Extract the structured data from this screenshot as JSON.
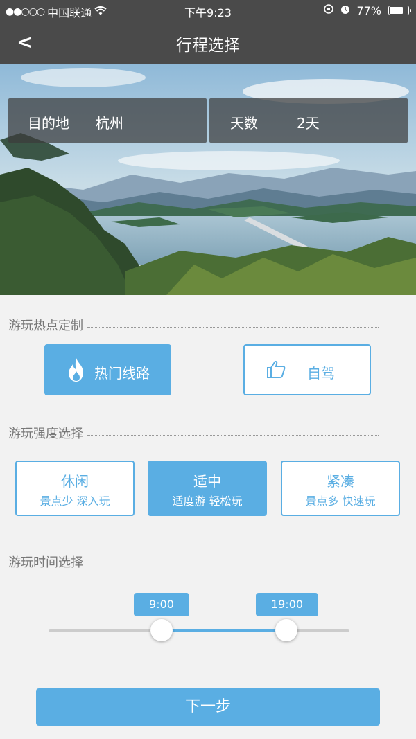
{
  "status_bar": {
    "signal": "●●○○○",
    "carrier": "中国联通",
    "time": "下午9:23",
    "battery": "77%",
    "battery_level": 0.77
  },
  "nav": {
    "back_label": "<",
    "title": "行程选择"
  },
  "trip": {
    "destination_label": "目的地",
    "destination_value": "杭州",
    "days_label": "天数",
    "days_value": "2天"
  },
  "hotspot": {
    "title": "游玩热点定制",
    "options": [
      {
        "label": "热门线路",
        "icon": "flame-icon",
        "selected": true
      },
      {
        "label": "自驾",
        "icon": "thumbs-up-icon",
        "selected": false
      }
    ]
  },
  "intensity": {
    "title": "游玩强度选择",
    "options": [
      {
        "label": "休闲",
        "desc": "景点少 深入玩",
        "selected": false
      },
      {
        "label": "适中",
        "desc": "适度游 轻松玩",
        "selected": true
      },
      {
        "label": "紧凑",
        "desc": "景点多 快速玩",
        "selected": false
      }
    ]
  },
  "time_range": {
    "title": "游玩时间选择",
    "start": "9:00",
    "end": "19:00",
    "start_fraction": 0.375,
    "end_fraction": 0.79
  },
  "footer": {
    "next_label": "下一步"
  },
  "colors": {
    "accent": "#5aaee3",
    "header_bg": "#4a4a4a",
    "page_bg": "#f2f2f2"
  }
}
